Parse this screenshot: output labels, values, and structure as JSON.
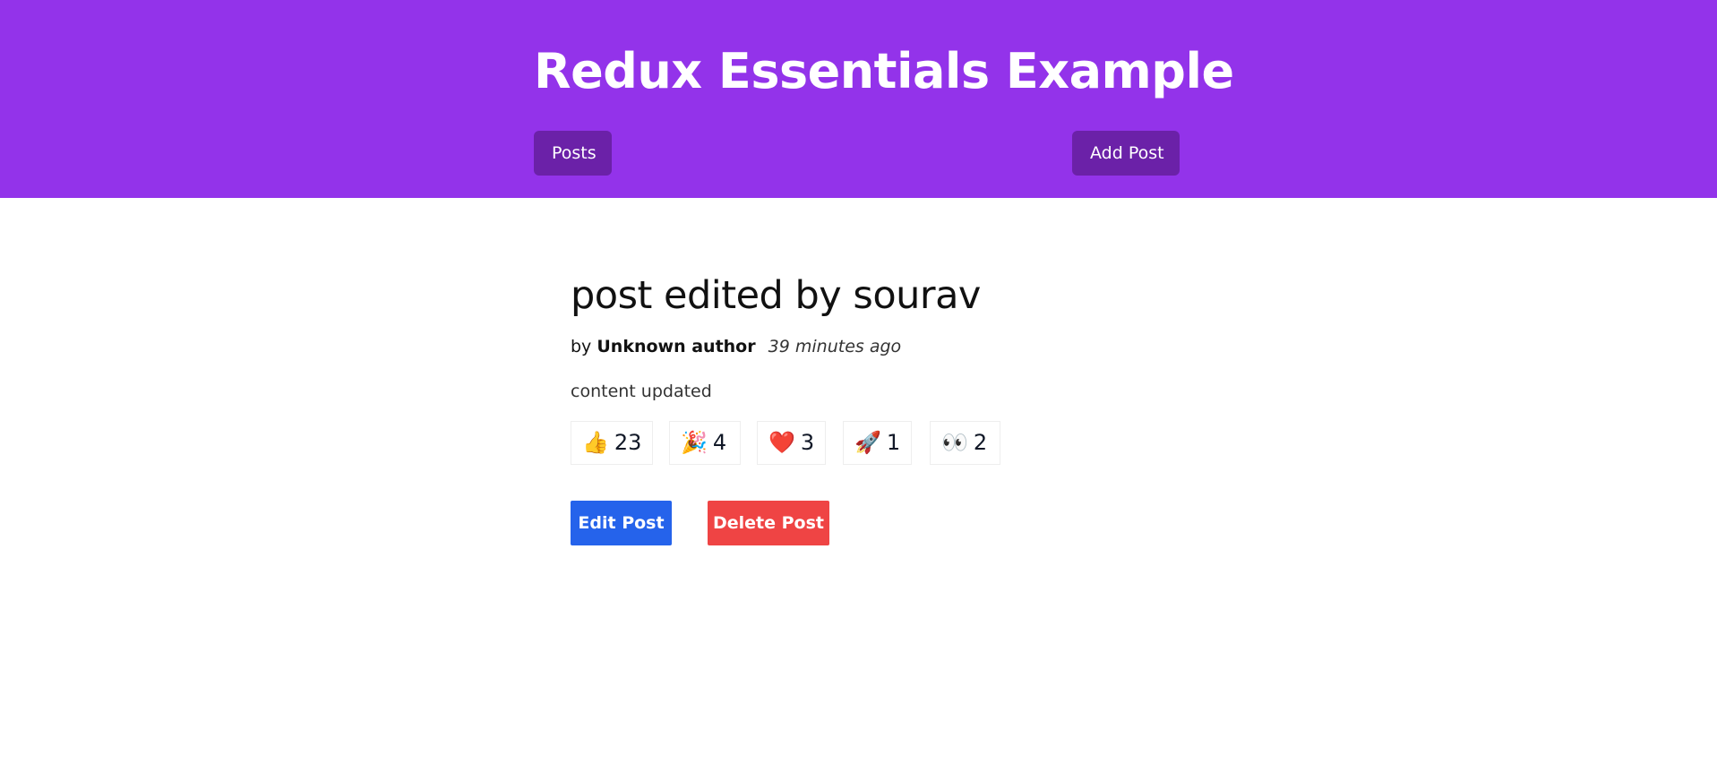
{
  "header": {
    "title": "Redux Essentials Example",
    "nav": {
      "posts_label": "Posts",
      "add_post_label": "Add Post"
    }
  },
  "post": {
    "title": "post edited by sourav",
    "by_prefix": "by",
    "author": "Unknown author",
    "time": "39 minutes ago",
    "content": "content updated",
    "reactions": [
      {
        "icon": "thumbs-up-icon",
        "emoji": "👍",
        "count": "23"
      },
      {
        "icon": "party-popper-icon",
        "emoji": "🎉",
        "count": "4"
      },
      {
        "icon": "heart-icon",
        "emoji": "❤️",
        "count": "3"
      },
      {
        "icon": "rocket-icon",
        "emoji": "🚀",
        "count": "1"
      },
      {
        "icon": "eyes-icon",
        "emoji": "👀",
        "count": "2"
      }
    ],
    "actions": {
      "edit_label": "Edit Post",
      "delete_label": "Delete Post"
    }
  },
  "colors": {
    "header_bg": "#9333ea",
    "nav_button_bg": "#6b21a8",
    "edit_button_bg": "#2563eb",
    "delete_button_bg": "#ef4444"
  }
}
